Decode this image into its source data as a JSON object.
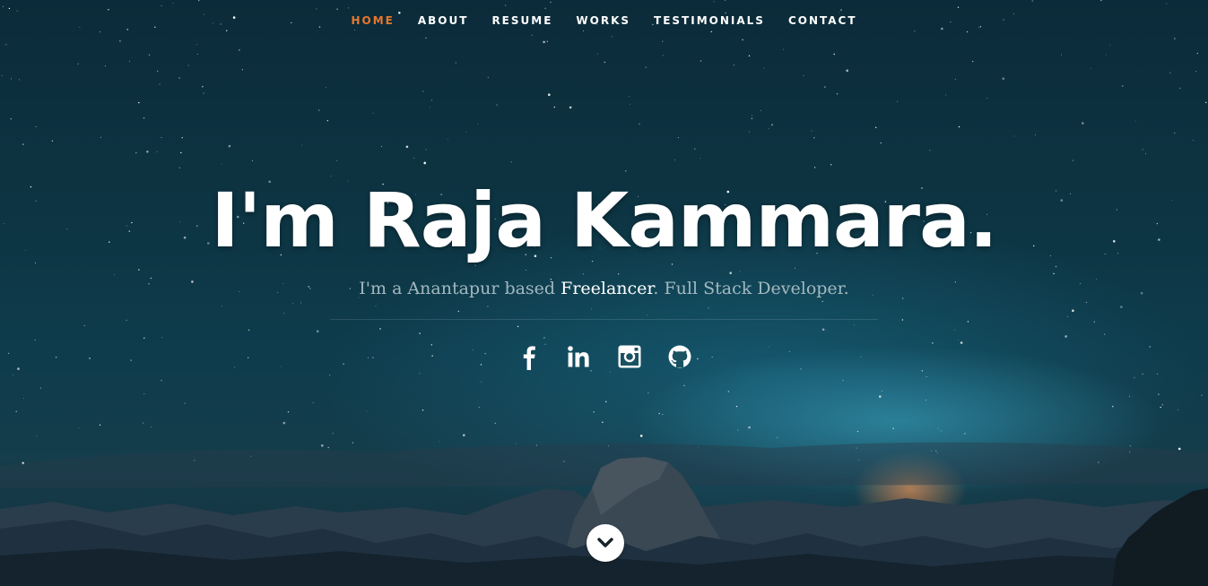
{
  "nav": {
    "items": [
      {
        "label": "HOME",
        "active": true
      },
      {
        "label": "ABOUT",
        "active": false
      },
      {
        "label": "RESUME",
        "active": false
      },
      {
        "label": "WORKS",
        "active": false
      },
      {
        "label": "TESTIMONIALS",
        "active": false
      },
      {
        "label": "CONTACT",
        "active": false
      }
    ],
    "active_color": "#e8782c"
  },
  "hero": {
    "headline": "I'm Raja Kammara.",
    "tagline_prefix": "I'm a Anantapur based ",
    "tagline_highlight": "Freelancer",
    "tagline_suffix": ". Full Stack Developer."
  },
  "social": [
    {
      "icon": "facebook-icon"
    },
    {
      "icon": "linkedin-icon"
    },
    {
      "icon": "instagram-icon"
    },
    {
      "icon": "github-icon"
    }
  ],
  "scroll": {
    "icon": "chevron-down-icon"
  }
}
